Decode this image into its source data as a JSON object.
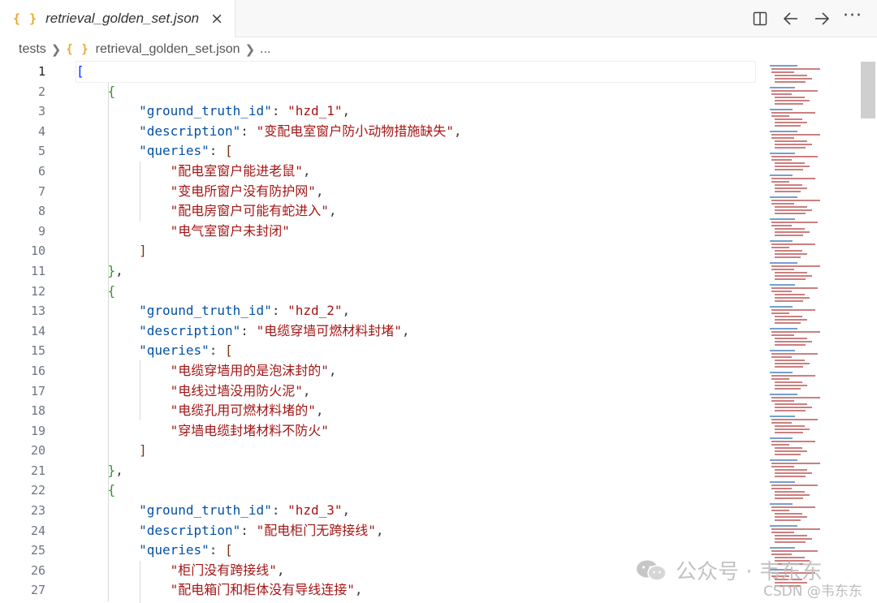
{
  "tab": {
    "icon": "{ }",
    "title": "retrieval_golden_set.json",
    "close": "×"
  },
  "actions": {
    "more": "···"
  },
  "breadcrumb": {
    "folder": "tests",
    "icon": "{ }",
    "file": "retrieval_golden_set.json",
    "ellipsis": "..."
  },
  "editor": {
    "line_numbers": [
      "1",
      "2",
      "3",
      "4",
      "5",
      "6",
      "7",
      "8",
      "9",
      "10",
      "11",
      "12",
      "13",
      "14",
      "15",
      "16",
      "17",
      "18",
      "19",
      "20",
      "21",
      "22",
      "23",
      "24",
      "25",
      "26",
      "27"
    ],
    "lines": [
      [
        [
          "b1",
          "["
        ]
      ],
      [
        [
          "p",
          "    "
        ],
        [
          "b2",
          "{"
        ]
      ],
      [
        [
          "p",
          "        "
        ],
        [
          "k",
          "\"ground_truth_id\""
        ],
        [
          "p",
          ": "
        ],
        [
          "s",
          "\"hzd_1\""
        ],
        [
          "p",
          ","
        ]
      ],
      [
        [
          "p",
          "        "
        ],
        [
          "k",
          "\"description\""
        ],
        [
          "p",
          ": "
        ],
        [
          "s",
          "\"变配电室窗户防小动物措施缺失\""
        ],
        [
          "p",
          ","
        ]
      ],
      [
        [
          "p",
          "        "
        ],
        [
          "k",
          "\"queries\""
        ],
        [
          "p",
          ": "
        ],
        [
          "b3",
          "["
        ]
      ],
      [
        [
          "p",
          "            "
        ],
        [
          "s",
          "\"配电室窗户能进老鼠\""
        ],
        [
          "p",
          ","
        ]
      ],
      [
        [
          "p",
          "            "
        ],
        [
          "s",
          "\"变电所窗户没有防护网\""
        ],
        [
          "p",
          ","
        ]
      ],
      [
        [
          "p",
          "            "
        ],
        [
          "s",
          "\"配电房窗户可能有蛇进入\""
        ],
        [
          "p",
          ","
        ]
      ],
      [
        [
          "p",
          "            "
        ],
        [
          "s",
          "\"电气室窗户未封闭\""
        ]
      ],
      [
        [
          "p",
          "        "
        ],
        [
          "b3",
          "]"
        ]
      ],
      [
        [
          "p",
          "    "
        ],
        [
          "b2",
          "}"
        ],
        [
          "p",
          ","
        ]
      ],
      [
        [
          "p",
          "    "
        ],
        [
          "b2",
          "{"
        ]
      ],
      [
        [
          "p",
          "        "
        ],
        [
          "k",
          "\"ground_truth_id\""
        ],
        [
          "p",
          ": "
        ],
        [
          "s",
          "\"hzd_2\""
        ],
        [
          "p",
          ","
        ]
      ],
      [
        [
          "p",
          "        "
        ],
        [
          "k",
          "\"description\""
        ],
        [
          "p",
          ": "
        ],
        [
          "s",
          "\"电缆穿墙可燃材料封堵\""
        ],
        [
          "p",
          ","
        ]
      ],
      [
        [
          "p",
          "        "
        ],
        [
          "k",
          "\"queries\""
        ],
        [
          "p",
          ": "
        ],
        [
          "b3",
          "["
        ]
      ],
      [
        [
          "p",
          "            "
        ],
        [
          "s",
          "\"电缆穿墙用的是泡沫封的\""
        ],
        [
          "p",
          ","
        ]
      ],
      [
        [
          "p",
          "            "
        ],
        [
          "s",
          "\"电线过墙没用防火泥\""
        ],
        [
          "p",
          ","
        ]
      ],
      [
        [
          "p",
          "            "
        ],
        [
          "s",
          "\"电缆孔用可燃材料堵的\""
        ],
        [
          "p",
          ","
        ]
      ],
      [
        [
          "p",
          "            "
        ],
        [
          "s",
          "\"穿墙电缆封堵材料不防火\""
        ]
      ],
      [
        [
          "p",
          "        "
        ],
        [
          "b3",
          "]"
        ]
      ],
      [
        [
          "p",
          "    "
        ],
        [
          "b2",
          "}"
        ],
        [
          "p",
          ","
        ]
      ],
      [
        [
          "p",
          "    "
        ],
        [
          "b2",
          "{"
        ]
      ],
      [
        [
          "p",
          "        "
        ],
        [
          "k",
          "\"ground_truth_id\""
        ],
        [
          "p",
          ": "
        ],
        [
          "s",
          "\"hzd_3\""
        ],
        [
          "p",
          ","
        ]
      ],
      [
        [
          "p",
          "        "
        ],
        [
          "k",
          "\"description\""
        ],
        [
          "p",
          ": "
        ],
        [
          "s",
          "\"配电柜门无跨接线\""
        ],
        [
          "p",
          ","
        ]
      ],
      [
        [
          "p",
          "        "
        ],
        [
          "k",
          "\"queries\""
        ],
        [
          "p",
          ": "
        ],
        [
          "b3",
          "["
        ]
      ],
      [
        [
          "p",
          "            "
        ],
        [
          "s",
          "\"柜门没有跨接线\""
        ],
        [
          "p",
          ","
        ]
      ],
      [
        [
          "p",
          "            "
        ],
        [
          "s",
          "\"配电箱门和柜体没有导线连接\""
        ],
        [
          "p",
          ","
        ]
      ]
    ]
  },
  "watermark": {
    "primary": "公众号 · 韦东东",
    "secondary": "CSDN @韦东东"
  },
  "colors": {
    "key": "#0451a5",
    "string": "#a31515",
    "bracket1": "#0431fa",
    "bracket2": "#319331",
    "bracket3": "#7b3814",
    "tab_icon": "#e8a830"
  }
}
